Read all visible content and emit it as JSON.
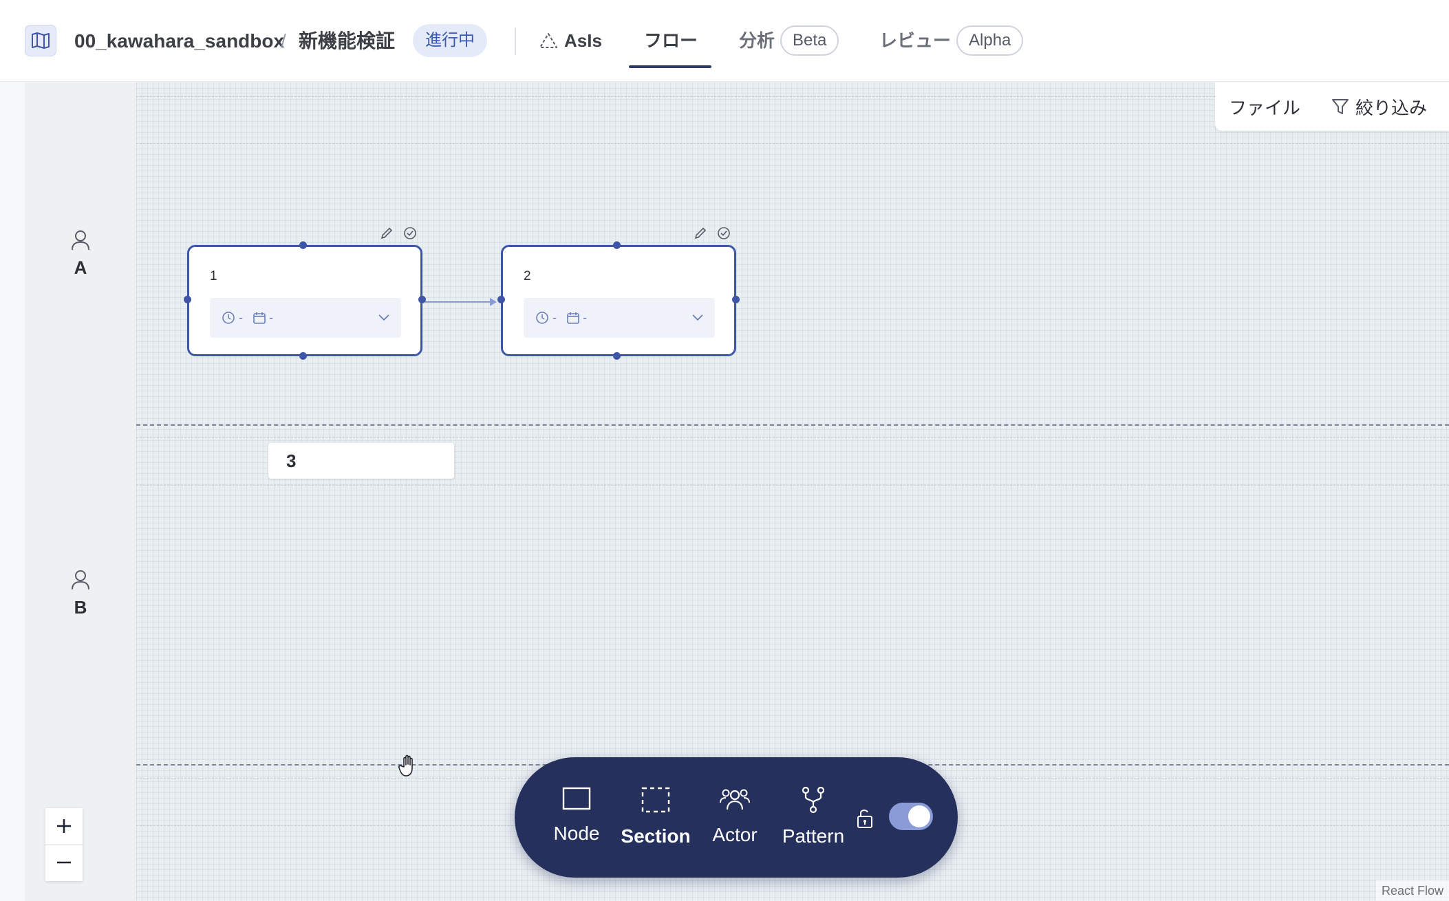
{
  "header": {
    "project": "00_kawahara_sandbox",
    "separator": "/",
    "page": "新機能検証",
    "status": "進行中",
    "tabs": [
      {
        "label": "AsIs",
        "icon": "triangle-icon"
      },
      {
        "label": "フロー",
        "active": true
      },
      {
        "label": "分析",
        "badge": "Beta"
      },
      {
        "label": "レビュー",
        "badge": "Alpha"
      }
    ]
  },
  "toolbar_top": {
    "file": "ファイル",
    "filter": "絞り込み"
  },
  "lanes": [
    {
      "actor": "A"
    },
    {
      "actor": "B"
    }
  ],
  "nodes": [
    {
      "label": "1",
      "time": "-",
      "date": "-"
    },
    {
      "label": "2",
      "time": "-",
      "date": "-"
    }
  ],
  "section_label": "3",
  "bottom_toolbar": {
    "items": [
      "Node",
      "Section",
      "Actor",
      "Pattern"
    ],
    "active": "Section",
    "toggle_on": true
  },
  "zoom": {
    "in": "+",
    "out": "−"
  },
  "attribution": "React Flow",
  "colors": {
    "accent": "#3f56a8",
    "toolbar_bg": "#26305c",
    "badge_bg": "#e4eaf8"
  }
}
